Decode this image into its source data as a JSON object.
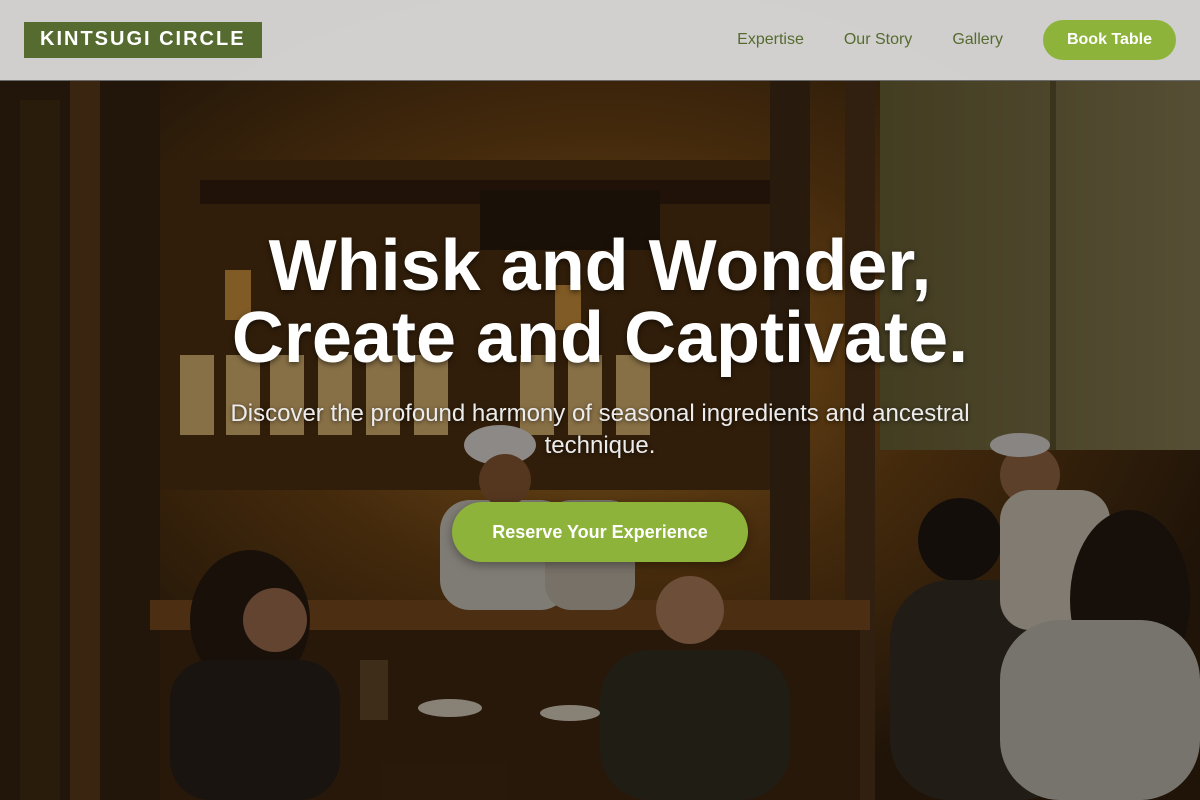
{
  "header": {
    "logo": "KINTSUGI CIRCLE",
    "nav": [
      {
        "label": "Expertise"
      },
      {
        "label": "Our Story"
      },
      {
        "label": "Gallery"
      }
    ],
    "book_button": "Book Table"
  },
  "hero": {
    "title_line1": "Whisk and Wonder,",
    "title_line2": "Create and Captivate.",
    "subtitle": "Discover the profound harmony of seasonal ingredients and ancestral technique.",
    "cta_label": "Reserve Your Experience",
    "background_image": "izakaya-interior-photo"
  },
  "colors": {
    "brand_green": "#556b2f",
    "accent_green": "#8db33a",
    "nav_background": "#dedede"
  }
}
